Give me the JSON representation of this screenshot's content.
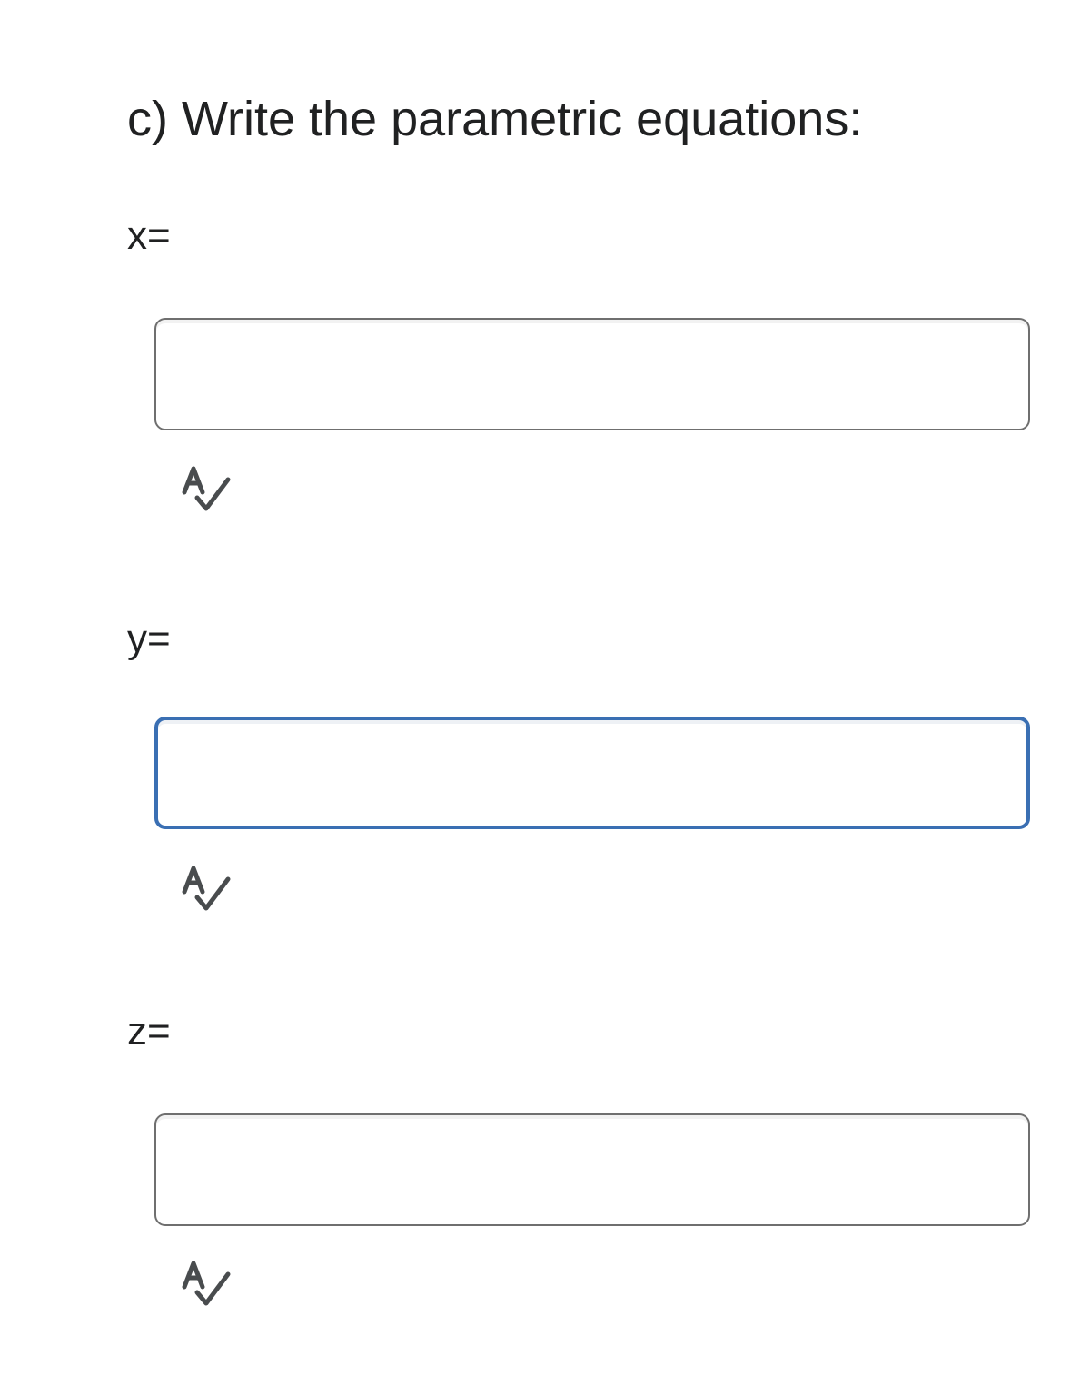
{
  "question": {
    "title": "c) Write the parametric equations:"
  },
  "fields": [
    {
      "label": "x=",
      "value": "",
      "placeholder": "",
      "focused": false,
      "icon": "spell-check-icon"
    },
    {
      "label": "y=",
      "value": "",
      "placeholder": "",
      "focused": true,
      "icon": "spell-check-icon"
    },
    {
      "label": "z=",
      "value": "",
      "placeholder": "",
      "focused": false,
      "icon": "spell-check-icon"
    }
  ],
  "colors": {
    "text": "#202122",
    "border": "#6f6f6f",
    "focus_border": "#3a6fb3",
    "icon": "#494c4e"
  }
}
